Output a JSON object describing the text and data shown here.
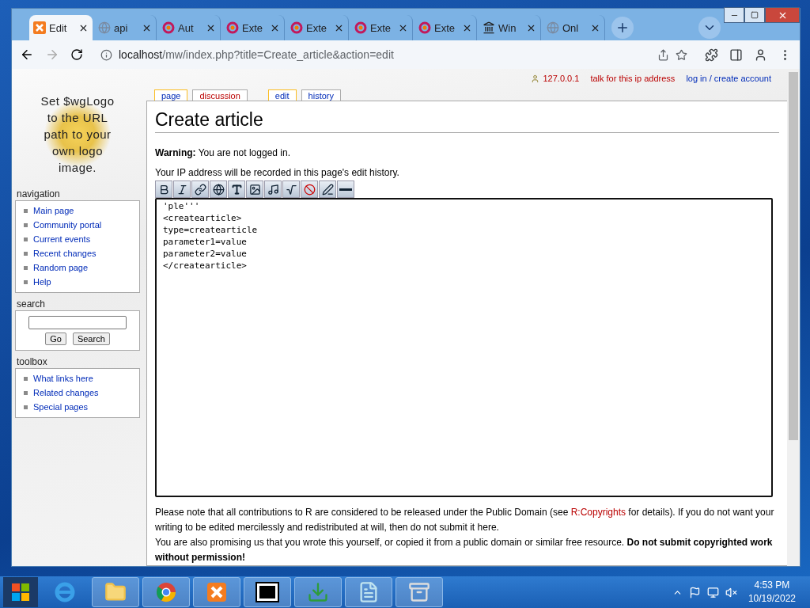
{
  "browser": {
    "tabs": [
      {
        "label": "Edit",
        "kind": "xampp",
        "selected": true
      },
      {
        "label": "api",
        "kind": "globe",
        "selected": false
      },
      {
        "label": "Aut",
        "kind": "ring",
        "selected": false
      },
      {
        "label": "Exte",
        "kind": "ring",
        "selected": false
      },
      {
        "label": "Exte",
        "kind": "ring",
        "selected": false
      },
      {
        "label": "Exte",
        "kind": "ring",
        "selected": false
      },
      {
        "label": "Exte",
        "kind": "ring",
        "selected": false
      },
      {
        "label": "Win",
        "kind": "museum",
        "selected": false
      },
      {
        "label": "Onl",
        "kind": "globe",
        "selected": false
      }
    ],
    "address": {
      "host": "localhost",
      "path": "/mw/index.php?title=Create_article&action=edit"
    }
  },
  "personal": {
    "ip": "127.0.0.1",
    "talk": "talk for this ip address",
    "login": "log in / create account"
  },
  "page_tabs": [
    {
      "label": "page",
      "selected": true,
      "new": false
    },
    {
      "label": "discussion",
      "selected": false,
      "new": true
    },
    {
      "label": "edit",
      "selected": true,
      "new": false
    },
    {
      "label": "history",
      "selected": false,
      "new": false
    }
  ],
  "logo": {
    "text": "Set $wgLogo to the URL path to your own logo image."
  },
  "navigation": {
    "title": "navigation",
    "items": [
      "Main page",
      "Community portal",
      "Current events",
      "Recent changes",
      "Random page",
      "Help"
    ]
  },
  "search": {
    "title": "search",
    "buttons": [
      "Go",
      "Search"
    ]
  },
  "toolbox": {
    "title": "toolbox",
    "items": [
      "What links here",
      "Related changes",
      "Special pages"
    ]
  },
  "content": {
    "heading": "Create article",
    "warning": "**Warning:** You are not logged in.",
    "ip_note": "Your IP address will be recorded in this page's edit history.",
    "toolbar": [
      {
        "kind": "bold"
      },
      {
        "kind": "italic"
      },
      {
        "kind": "link"
      },
      {
        "kind": "globe"
      },
      {
        "kind": "headline"
      },
      {
        "kind": "image"
      },
      {
        "kind": "media"
      },
      {
        "kind": "math"
      },
      {
        "kind": "nowiki"
      },
      {
        "kind": "signature"
      },
      {
        "kind": "rule"
      }
    ],
    "editor_lines": [
      "'ple'''",
      "<createarticle>",
      "type=createarticle",
      "parameter1=value",
      "parameter2=value",
      "</createarticle>"
    ],
    "notice_before": "Please note that all contributions to R are considered to be released under the Public Domain (see ",
    "notice_link": "R:Copyrights",
    "notice_after": " for details). If you do not want your writing to be edited mercilessly and redistributed at will, then do not submit it here.",
    "promise": "You are also promising us that you wrote this yourself, or copied it from a public domain or similar free resource. **Do not submit copyrighted work without permission!**"
  },
  "taskbar": {
    "apps": [
      {
        "kind": "ie",
        "running": false
      },
      {
        "kind": "folder",
        "running": true
      },
      {
        "kind": "chrome",
        "running": true
      },
      {
        "kind": "xampp",
        "running": true
      },
      {
        "kind": "sevenzip",
        "running": true
      },
      {
        "kind": "download",
        "running": true
      },
      {
        "kind": "notepad",
        "running": true
      },
      {
        "kind": "archive",
        "running": true
      }
    ],
    "time": "4:53 PM",
    "date": "10/19/2022"
  }
}
